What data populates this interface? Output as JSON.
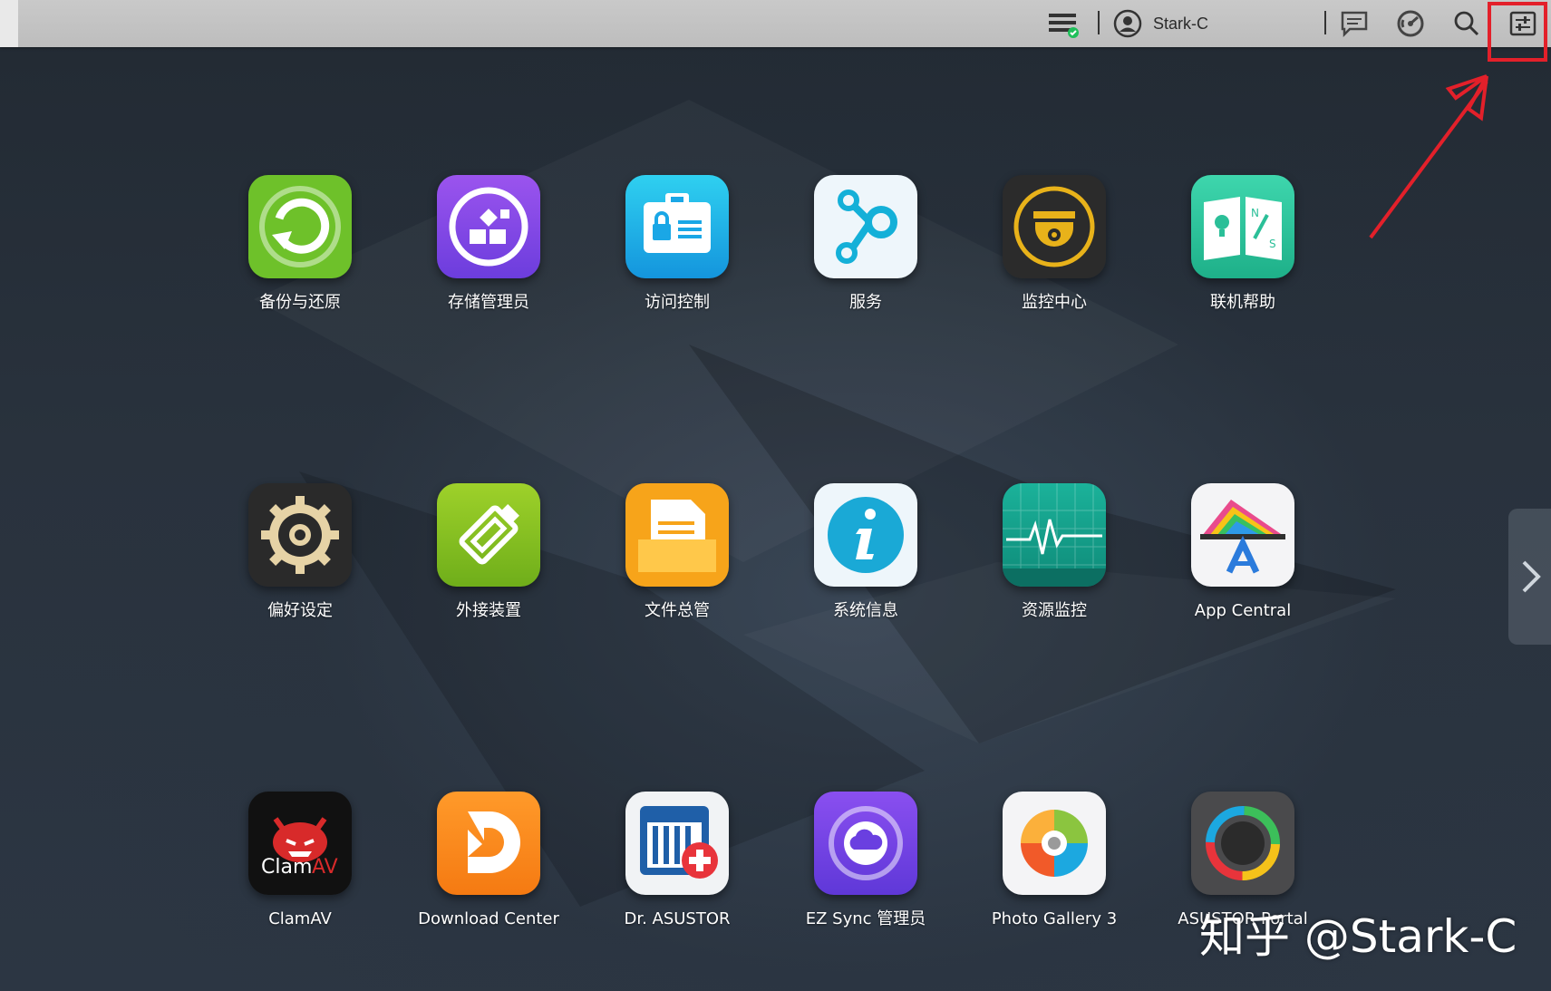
{
  "topbar": {
    "username": "Stark-C"
  },
  "apps": [
    {
      "label": "备份与还原",
      "icon": "backup-restore-icon"
    },
    {
      "label": "存储管理员",
      "icon": "storage-manager-icon"
    },
    {
      "label": "访问控制",
      "icon": "access-control-icon"
    },
    {
      "label": "服务",
      "icon": "services-icon"
    },
    {
      "label": "监控中心",
      "icon": "monitor-center-icon"
    },
    {
      "label": "联机帮助",
      "icon": "online-help-icon"
    },
    {
      "label": "偏好设定",
      "icon": "preferences-gear-icon"
    },
    {
      "label": "外接装置",
      "icon": "external-devices-icon"
    },
    {
      "label": "文件总管",
      "icon": "file-explorer-icon"
    },
    {
      "label": "系统信息",
      "icon": "system-info-icon"
    },
    {
      "label": "资源监控",
      "icon": "resource-monitor-icon"
    },
    {
      "label": "App Central",
      "icon": "app-central-icon"
    },
    {
      "label": "ClamAV",
      "icon": "clamav-icon"
    },
    {
      "label": "Download Center",
      "icon": "download-center-icon"
    },
    {
      "label": "Dr. ASUSTOR",
      "icon": "dr-asustor-icon"
    },
    {
      "label": "EZ Sync 管理员",
      "icon": "ez-sync-icon"
    },
    {
      "label": "Photo Gallery 3",
      "icon": "photo-gallery-icon"
    },
    {
      "label": "ASUSTOR Portal",
      "icon": "asustor-portal-icon"
    }
  ],
  "watermark": "知乎 @Stark-C",
  "colors": {
    "highlight": "#e3202a",
    "desktop": "#262e38"
  }
}
